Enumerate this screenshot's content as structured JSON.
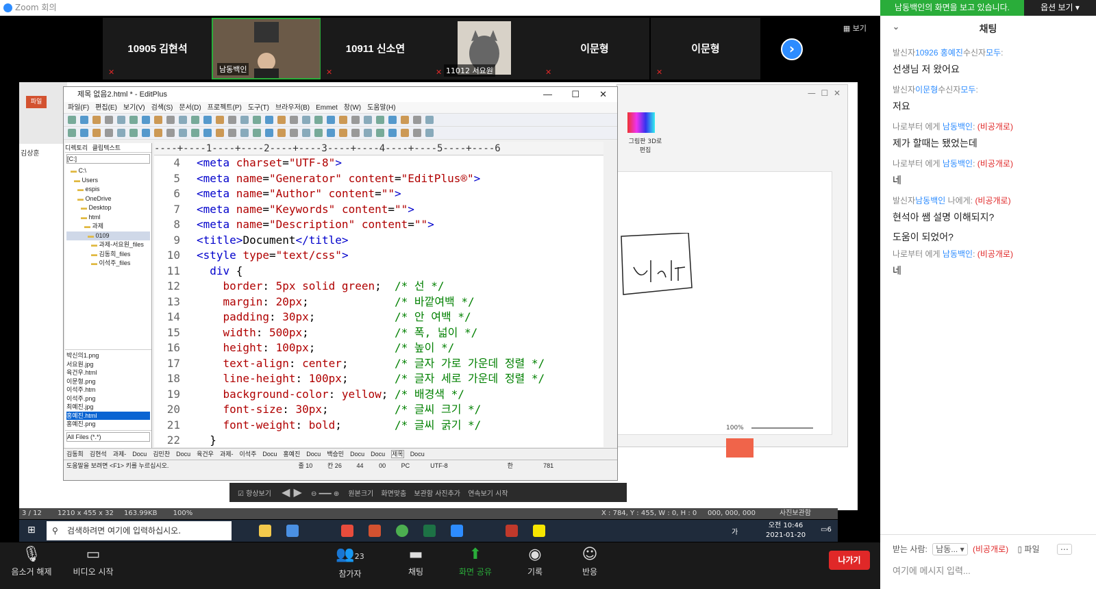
{
  "zoom": {
    "window_title": "Zoom 회의",
    "view_label": "보기",
    "participants": [
      {
        "name": "10905 김현석"
      },
      {
        "name": "남동백인",
        "video": true
      },
      {
        "name": "10911 신소연"
      },
      {
        "name": "11012 서요원",
        "video": true
      },
      {
        "name": "이문형"
      },
      {
        "name": "이문형"
      }
    ],
    "toolbar": {
      "unmute": "음소거 해제",
      "start_video": "비디오 시작",
      "participants": "참가자",
      "participants_count": "23",
      "chat": "채팅",
      "share_screen": "화면 공유",
      "record": "기록",
      "reactions": "반응",
      "leave": "나가기"
    }
  },
  "chat": {
    "viewing_banner": "남동백인의 화면을 보고 있습니다.",
    "view_options": "옵션 보기",
    "title": "채팅",
    "messages": [
      {
        "meta_prefix": "발신자",
        "sender": "10926 홍예진",
        "meta_mid": "수신자",
        "recipient": "모두",
        "meta_suffix": ":",
        "private": "",
        "lines": [
          "선생님 저 왔어요"
        ]
      },
      {
        "meta_prefix": "발신자",
        "sender": "이문형",
        "meta_mid": "수신자",
        "recipient": "모두",
        "meta_suffix": ":",
        "private": "",
        "lines": [
          "저요"
        ]
      },
      {
        "meta_prefix": "나로부터 에게 ",
        "sender": "남동백인",
        "meta_mid": ":",
        "recipient": "",
        "meta_suffix": " ",
        "private": "(비공개로)",
        "lines": [
          "제가 할때는 됐었는데"
        ]
      },
      {
        "meta_prefix": "나로부터 에게 ",
        "sender": "남동백인",
        "meta_mid": ":",
        "recipient": "",
        "meta_suffix": " ",
        "private": "(비공개로)",
        "lines": [
          "네"
        ]
      },
      {
        "meta_prefix": "발신자",
        "sender": "남동백인",
        "meta_mid": " 나에게:",
        "recipient": "",
        "meta_suffix": " ",
        "private": "(비공개로)",
        "lines": [
          "현석아 쌤 설명 이해되지?",
          "도움이 되었어?"
        ]
      },
      {
        "meta_prefix": "나로부터 에게 ",
        "sender": "남동백인",
        "meta_mid": ":",
        "recipient": "",
        "meta_suffix": " ",
        "private": "(비공개로)",
        "lines": [
          "네"
        ]
      }
    ],
    "to_label": "받는 사람:",
    "to_value": "남동...",
    "to_private": "(비공개로)",
    "file_label": "파일",
    "input_placeholder": "여기에 메시지 입력..."
  },
  "editplus": {
    "title": "제목 없음2.html * - EditPlus",
    "menu": [
      "파일(F)",
      "편집(E)",
      "보기(V)",
      "검색(S)",
      "문서(D)",
      "프로젝트(P)",
      "도구(T)",
      "브라우저(B)",
      "Emmet",
      "창(W)",
      "도움말(H)"
    ],
    "dir_tabs": [
      "디렉토리",
      "클립텍스트"
    ],
    "drive": "[C:]",
    "tree": [
      "C:\\",
      "Users",
      "espis",
      "OneDrive",
      "Desktop",
      "html",
      "과제",
      "0109",
      "과제-서요원_files",
      "김동희_files",
      "이석주_files"
    ],
    "files": [
      "박신의1.png",
      "서요원.jpg",
      "육건우.html",
      "이문형.png",
      "이석주.htm",
      "이석주.png",
      "최예진.jpg",
      "홍예진.html",
      "홍예진.png"
    ],
    "selected_file": "홍예진.html",
    "filter": "All Files (*.*)",
    "ruler": "----+----1----+----2----+----3----+----4----+----5----+----6",
    "code": [
      {
        "n": "4",
        "parts": [
          [
            "tg",
            "<meta "
          ],
          [
            "at",
            "charset"
          ],
          [
            "tx",
            "="
          ],
          [
            "vl",
            "\"UTF-8\""
          ],
          [
            "tg",
            ">"
          ]
        ]
      },
      {
        "n": "5",
        "parts": [
          [
            "tg",
            "<meta "
          ],
          [
            "at",
            "name"
          ],
          [
            "tx",
            "="
          ],
          [
            "vl",
            "\"Generator\" "
          ],
          [
            "at",
            "content"
          ],
          [
            "tx",
            "="
          ],
          [
            "vl",
            "\"EditPlus®\""
          ],
          [
            "tg",
            ">"
          ]
        ]
      },
      {
        "n": "6",
        "parts": [
          [
            "tg",
            "<meta "
          ],
          [
            "at",
            "name"
          ],
          [
            "tx",
            "="
          ],
          [
            "vl",
            "\"Author\" "
          ],
          [
            "at",
            "content"
          ],
          [
            "tx",
            "="
          ],
          [
            "vl",
            "\"\""
          ],
          [
            "tg",
            ">"
          ]
        ]
      },
      {
        "n": "7",
        "parts": [
          [
            "tg",
            "<meta "
          ],
          [
            "at",
            "name"
          ],
          [
            "tx",
            "="
          ],
          [
            "vl",
            "\"Keywords\" "
          ],
          [
            "at",
            "content"
          ],
          [
            "tx",
            "="
          ],
          [
            "vl",
            "\"\""
          ],
          [
            "tg",
            ">"
          ]
        ]
      },
      {
        "n": "8",
        "parts": [
          [
            "tg",
            "<meta "
          ],
          [
            "at",
            "name"
          ],
          [
            "tx",
            "="
          ],
          [
            "vl",
            "\"Description\" "
          ],
          [
            "at",
            "content"
          ],
          [
            "tx",
            "="
          ],
          [
            "vl",
            "\"\""
          ],
          [
            "tg",
            ">"
          ]
        ]
      },
      {
        "n": "9",
        "parts": [
          [
            "tg",
            "<title>"
          ],
          [
            "tx",
            "Document"
          ],
          [
            "tg",
            "</title>"
          ]
        ]
      },
      {
        "n": "10",
        "parts": [
          [
            "tg",
            "<style "
          ],
          [
            "at",
            "type"
          ],
          [
            "tx",
            "="
          ],
          [
            "vl",
            "\"text/css\""
          ],
          [
            "tg",
            ">"
          ]
        ]
      },
      {
        "n": "11",
        "parts": [
          [
            "tx",
            "  "
          ],
          [
            "tg",
            "div "
          ],
          [
            "tx",
            "{"
          ]
        ]
      },
      {
        "n": "12",
        "parts": [
          [
            "tx",
            "    "
          ],
          [
            "pr",
            "border"
          ],
          [
            "tx",
            ": "
          ],
          [
            "vl",
            "5px solid green"
          ],
          [
            "tx",
            ";  "
          ],
          [
            "cm",
            "/* 선 */"
          ]
        ]
      },
      {
        "n": "13",
        "parts": [
          [
            "tx",
            "    "
          ],
          [
            "pr",
            "margin"
          ],
          [
            "tx",
            ": "
          ],
          [
            "vl",
            "20px"
          ],
          [
            "tx",
            ";             "
          ],
          [
            "cm",
            "/* 바깥여백 */"
          ]
        ]
      },
      {
        "n": "14",
        "parts": [
          [
            "tx",
            "    "
          ],
          [
            "pr",
            "padding"
          ],
          [
            "tx",
            ": "
          ],
          [
            "vl",
            "30px"
          ],
          [
            "tx",
            ";            "
          ],
          [
            "cm",
            "/* 안 여백 */"
          ]
        ]
      },
      {
        "n": "15",
        "parts": [
          [
            "tx",
            "    "
          ],
          [
            "pr",
            "width"
          ],
          [
            "tx",
            ": "
          ],
          [
            "vl",
            "500px"
          ],
          [
            "tx",
            ";             "
          ],
          [
            "cm",
            "/* 폭, 넓이 */"
          ]
        ]
      },
      {
        "n": "16",
        "parts": [
          [
            "tx",
            "    "
          ],
          [
            "pr",
            "height"
          ],
          [
            "tx",
            ": "
          ],
          [
            "vl",
            "100px"
          ],
          [
            "tx",
            ";            "
          ],
          [
            "cm",
            "/* 높이 */"
          ]
        ]
      },
      {
        "n": "17",
        "parts": [
          [
            "tx",
            "    "
          ],
          [
            "pr",
            "text-align"
          ],
          [
            "tx",
            ": "
          ],
          [
            "vl",
            "center"
          ],
          [
            "tx",
            ";       "
          ],
          [
            "cm",
            "/* 글자 가로 가운데 정렬 */"
          ]
        ]
      },
      {
        "n": "18",
        "parts": [
          [
            "tx",
            "    "
          ],
          [
            "pr",
            "line-height"
          ],
          [
            "tx",
            ": "
          ],
          [
            "vl",
            "100px"
          ],
          [
            "tx",
            ";       "
          ],
          [
            "cm",
            "/* 글자 세로 가운데 정렬 */"
          ]
        ]
      },
      {
        "n": "19",
        "parts": [
          [
            "tx",
            "    "
          ],
          [
            "pr",
            "background-color"
          ],
          [
            "tx",
            ": "
          ],
          [
            "vl",
            "yellow"
          ],
          [
            "tx",
            "; "
          ],
          [
            "cm",
            "/* 배경색 */"
          ]
        ]
      },
      {
        "n": "20",
        "parts": [
          [
            "tx",
            "    "
          ],
          [
            "pr",
            "font-size"
          ],
          [
            "tx",
            ": "
          ],
          [
            "vl",
            "30px"
          ],
          [
            "tx",
            ";          "
          ],
          [
            "cm",
            "/* 글씨 크기 */"
          ]
        ]
      },
      {
        "n": "21",
        "parts": [
          [
            "tx",
            "    "
          ],
          [
            "pr",
            "font-weight"
          ],
          [
            "tx",
            ": "
          ],
          [
            "vl",
            "bold"
          ],
          [
            "tx",
            ";        "
          ],
          [
            "cm",
            "/* 글씨 굵기 */"
          ]
        ]
      },
      {
        "n": "22",
        "parts": [
          [
            "tx",
            "  }"
          ]
        ]
      }
    ],
    "doc_tabs": [
      "김동희",
      "김현석",
      "과제-",
      "Docu",
      "김민찬",
      "Docu",
      "육건우",
      "과제-",
      "이석주",
      "Docu",
      "홍예진",
      "Docu",
      "백승민",
      "Docu",
      "Docu",
      "제목",
      "Docu"
    ],
    "status": {
      "help": "도움말을 보려면 <F1> 키를 누르십시오.",
      "line": "줄 10",
      "col": "칸 26",
      "n1": "44",
      "n2": "00",
      "mode": "PC",
      "encoding": "UTF-8",
      "ime": "한",
      "size": "781"
    }
  },
  "viewer": {
    "paint3d_label": "그림판 3D로 편집",
    "zoom_pct": "100%",
    "bar_buttons": [
      "항상보기",
      "원본크기",
      "화면맞춤",
      "보관함 사진추가",
      "연속보기 시작"
    ],
    "status_left": "3 / 12",
    "status_dims": "1210 x 455 x 32",
    "status_size": "163.99KB",
    "status_zoom": "100%",
    "status_coords": "X : 784, Y : 455, W : 0, H : 0",
    "status_color": "000, 000, 000",
    "status_album": "사진보관함",
    "left_name": "김상훈"
  },
  "taskbar": {
    "search_placeholder": "검색하려면 여기에 입력하십시오.",
    "time": "오전 10:46",
    "date": "2021-01-20",
    "lang": "가",
    "notif_count": "6"
  }
}
